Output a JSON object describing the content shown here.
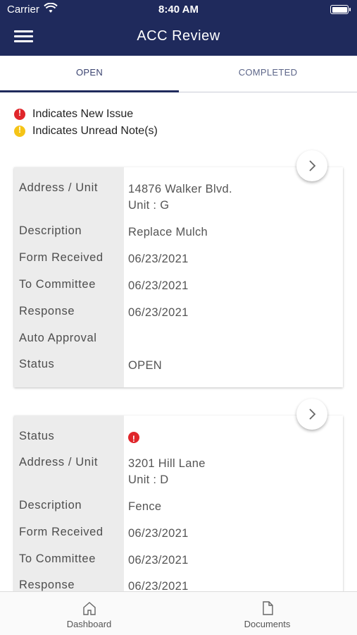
{
  "status_bar": {
    "carrier": "Carrier",
    "time": "8:40 AM"
  },
  "header": {
    "title": "ACC Review",
    "menu_icon": "hamburger-menu-icon"
  },
  "tabs": [
    {
      "label": "OPEN",
      "active": true
    },
    {
      "label": "COMPLETED",
      "active": false
    }
  ],
  "legend": [
    {
      "text": "Indicates New Issue",
      "color": "#e0262b",
      "icon": "alert-red-icon"
    },
    {
      "text": "Indicates Unread Note(s)",
      "color": "#f5c417",
      "icon": "alert-yellow-icon"
    }
  ],
  "cards": [
    {
      "rows": [
        {
          "label": "Address / Unit",
          "value_lines": [
            "14876 Walker Blvd.",
            "Unit : G"
          ]
        },
        {
          "label": "Description",
          "value_lines": [
            "Replace Mulch"
          ]
        },
        {
          "label": "Form Received",
          "value_lines": [
            "06/23/2021"
          ]
        },
        {
          "label": "To Committee",
          "value_lines": [
            "06/23/2021"
          ]
        },
        {
          "label": "Response",
          "value_lines": [
            "06/23/2021"
          ]
        },
        {
          "label": "Auto Approval",
          "value_lines": [
            ""
          ]
        },
        {
          "label": "Status",
          "value_lines": [
            "OPEN"
          ]
        }
      ]
    },
    {
      "rows": [
        {
          "label": "Status",
          "value_lines": [
            ""
          ],
          "new_issue": true
        },
        {
          "label": "Address / Unit",
          "value_lines": [
            "3201 Hill Lane",
            "Unit : D"
          ]
        },
        {
          "label": "Description",
          "value_lines": [
            "Fence"
          ]
        },
        {
          "label": "Form Received",
          "value_lines": [
            "06/23/2021"
          ]
        },
        {
          "label": "To Committee",
          "value_lines": [
            "06/23/2021"
          ]
        },
        {
          "label": "Response",
          "value_lines": [
            "06/23/2021"
          ]
        }
      ]
    }
  ],
  "bottom_nav": [
    {
      "label": "Dashboard",
      "icon": "home-icon"
    },
    {
      "label": "Documents",
      "icon": "document-icon"
    }
  ],
  "colors": {
    "header_bg": "#1f2a5c",
    "label_bg": "#ececec",
    "alert_red": "#e0262b",
    "alert_yellow": "#f5c417"
  }
}
